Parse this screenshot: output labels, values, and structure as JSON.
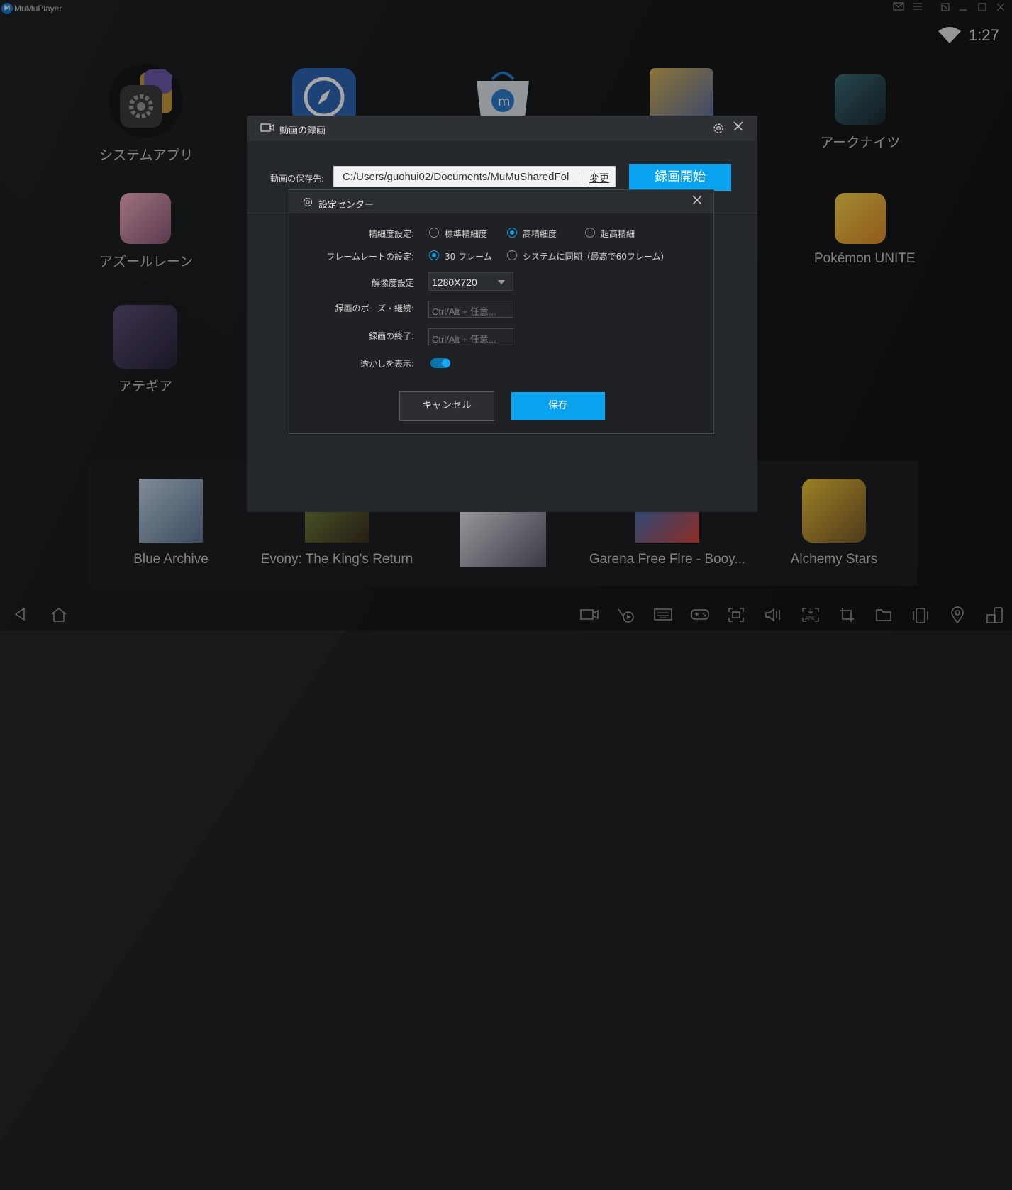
{
  "window": {
    "title": "MuMuPlayer",
    "logo_text": "M"
  },
  "status_bar": {
    "time": "1:27"
  },
  "apps": {
    "system": "システムアプリ",
    "arknights": "アークナイツ",
    "azurlane": "アズールレーン",
    "pokemon": "Pokémon UNITE",
    "ategear": "アテギア",
    "blue_archive": "Blue Archive",
    "evony": "Evony: The King's Return",
    "freefire": "Garena Free Fire - Booy...",
    "alchemy": "Alchemy Stars"
  },
  "record_dialog": {
    "title": "動画の録画",
    "save_label": "動画の保存先:",
    "path_value": "C:/Users/guohui02/Documents/MuMuSharedFol",
    "change_label": "変更",
    "start_label": "録画開始"
  },
  "settings_dialog": {
    "title": "設定センター",
    "quality": {
      "label": "精細度設定:",
      "options": [
        "標準精細度",
        "高精細度",
        "超高精細"
      ],
      "selected": "高精細度"
    },
    "framerate": {
      "label": "フレームレートの設定:",
      "options": [
        "30 フレーム",
        "システムに同期（最高で60フレーム）"
      ],
      "selected": "30 フレーム"
    },
    "resolution": {
      "label": "解像度設定",
      "value": "1280X720"
    },
    "pause_shortcut": {
      "label": "録画のポーズ・継続:",
      "placeholder": "Ctrl/Alt + 任意..."
    },
    "end_shortcut": {
      "label": "録画の終了:",
      "placeholder": "Ctrl/Alt + 任意..."
    },
    "watermark": {
      "label": "透かしを表示:",
      "enabled": true
    },
    "cancel_label": "キャンセル",
    "save_label": "保存"
  },
  "colors": {
    "accent": "#0aa3f0",
    "background": "#151617"
  }
}
